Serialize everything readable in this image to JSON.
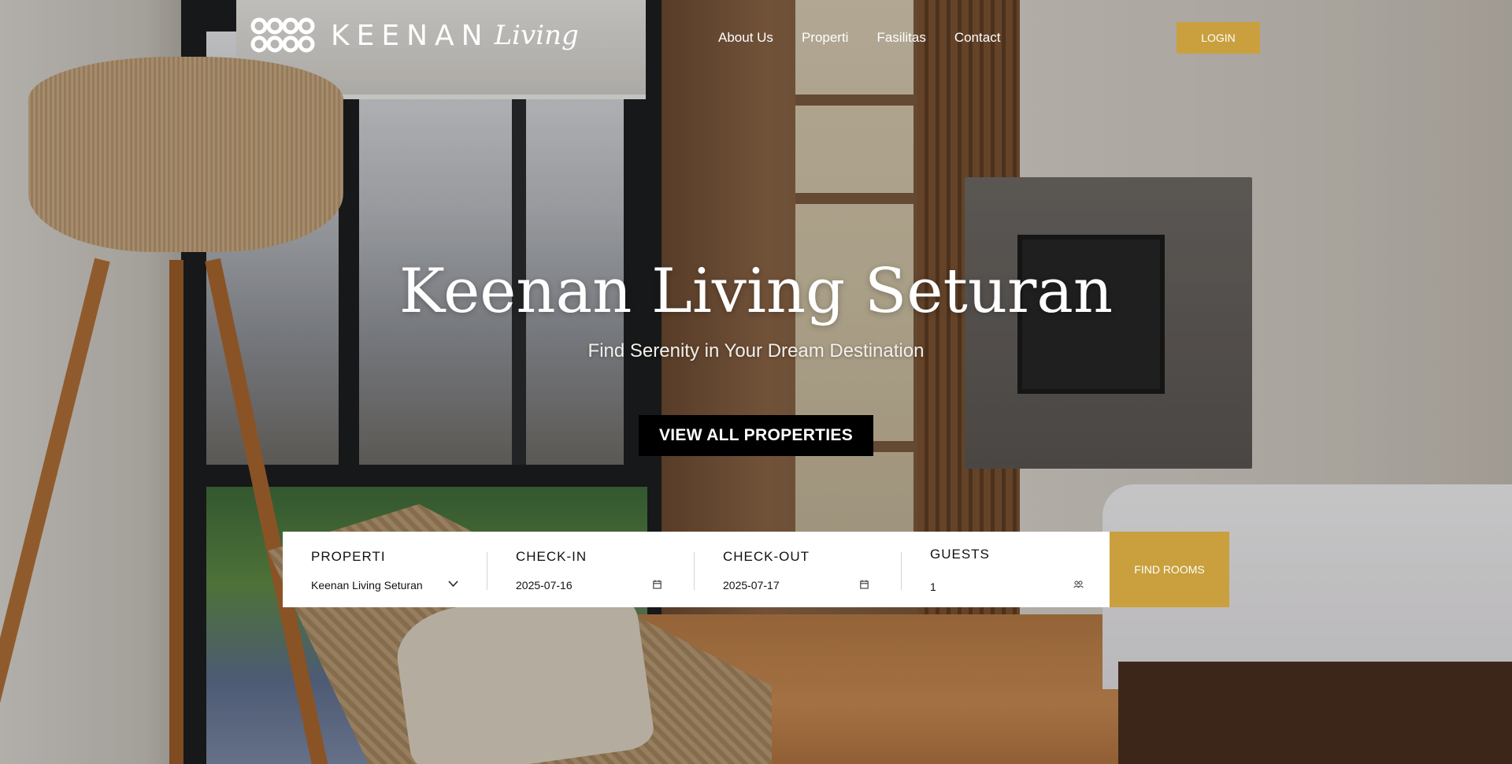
{
  "brand": {
    "name": "KEENAN",
    "script": "Living",
    "accent_color": "#c9a03d"
  },
  "nav": {
    "items": [
      {
        "label": "About Us"
      },
      {
        "label": "Properti"
      },
      {
        "label": "Fasilitas"
      },
      {
        "label": "Contact"
      }
    ],
    "login_label": "LOGIN"
  },
  "hero": {
    "title": "Keenan Living Seturan",
    "subtitle": "Find Serenity in Your Dream Destination",
    "cta_label": "VIEW ALL PROPERTIES"
  },
  "booking": {
    "property": {
      "label": "PROPERTI",
      "value": "Keenan Living Seturan",
      "icon": "chevron-down-icon"
    },
    "checkin": {
      "label": "CHECK-IN",
      "value": "2025-07-16",
      "icon": "calendar-icon"
    },
    "checkout": {
      "label": "CHECK-OUT",
      "value": "2025-07-17",
      "icon": "calendar-icon"
    },
    "guests": {
      "label": "GUESTS",
      "value": "1",
      "icon": "users-icon"
    },
    "submit_label": "FIND ROOMS"
  }
}
